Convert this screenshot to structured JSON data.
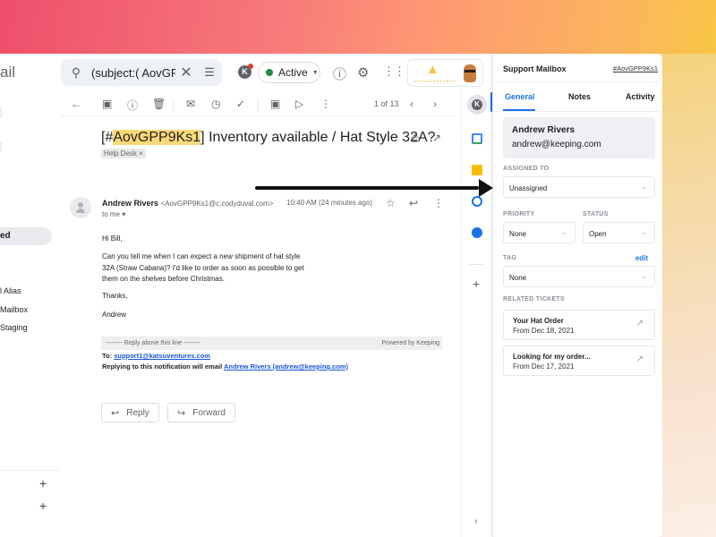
{
  "colors": {
    "accent": "#1a73e8",
    "status_active": "#1e8e3e",
    "highlight": "#fcd978"
  },
  "gmail": {
    "brand_partial": "ail",
    "search": {
      "query": "(subject:( AovGPP"
    },
    "status": {
      "label": "Active"
    },
    "account": {
      "logo_text": "KATSUVENTURES"
    },
    "toolbar": {
      "pager": "1 of 13"
    },
    "subject": {
      "prefix": "[#",
      "ticket_id": "AovGPP9Ks1",
      "suffix": "] Inventory available / Hat Style 32A?",
      "label_chip": "Help Desk ×"
    },
    "message": {
      "sender_name": "Andrew Rivers",
      "sender_addr": "<AovGPP9Ks1@c.codyduval.com>",
      "to": "to me ▾",
      "time": "10:40 AM (24 minutes ago)",
      "greeting": "Hi Bill,",
      "paragraph": "Can you tell me when I can expect a new shipment of hat style 32A (Straw Cabana)? I'd like to order as soon as possible to get them on the shelves before Christmas.",
      "thanks": "Thanks,",
      "signature": "Andrew",
      "reply_above": "-------- Reply above this line --------",
      "powered_by": "Powered by Keeping",
      "to_label": "To: ",
      "to_email": "support1@katsuventures.com",
      "replying_label": "Replying to this notification will email ",
      "replying_link": "Andrew Rivers (andrew@keeping.com)"
    },
    "actions": {
      "reply": "Reply",
      "forward": "Forward"
    },
    "nav": {
      "active_item": "ed",
      "items": [
        "l Alias",
        "Mailbox",
        "Staging"
      ]
    }
  },
  "panel": {
    "title": "Support Mailbox",
    "ticket_link": "#AovGPP9Ks1",
    "tabs": [
      {
        "label": "General",
        "active": true
      },
      {
        "label": "Notes",
        "active": false
      },
      {
        "label": "Activity",
        "active": false
      }
    ],
    "contact": {
      "name": "Andrew Rivers",
      "email": "andrew@keeping.com"
    },
    "assigned_to": {
      "label": "ASSIGNED TO",
      "value": "Unassigned"
    },
    "priority": {
      "label": "PRIORITY",
      "value": "None"
    },
    "status": {
      "label": "STATUS",
      "value": "Open"
    },
    "tag": {
      "label": "TAG",
      "edit": "edit",
      "value": "None"
    },
    "related": {
      "label": "RELATED TICKETS",
      "tickets": [
        {
          "title": "Your Hat Order",
          "date": "From Dec 18, 2021"
        },
        {
          "title": "Looking for my order...",
          "date": "From Dec 17, 2021"
        }
      ]
    }
  }
}
